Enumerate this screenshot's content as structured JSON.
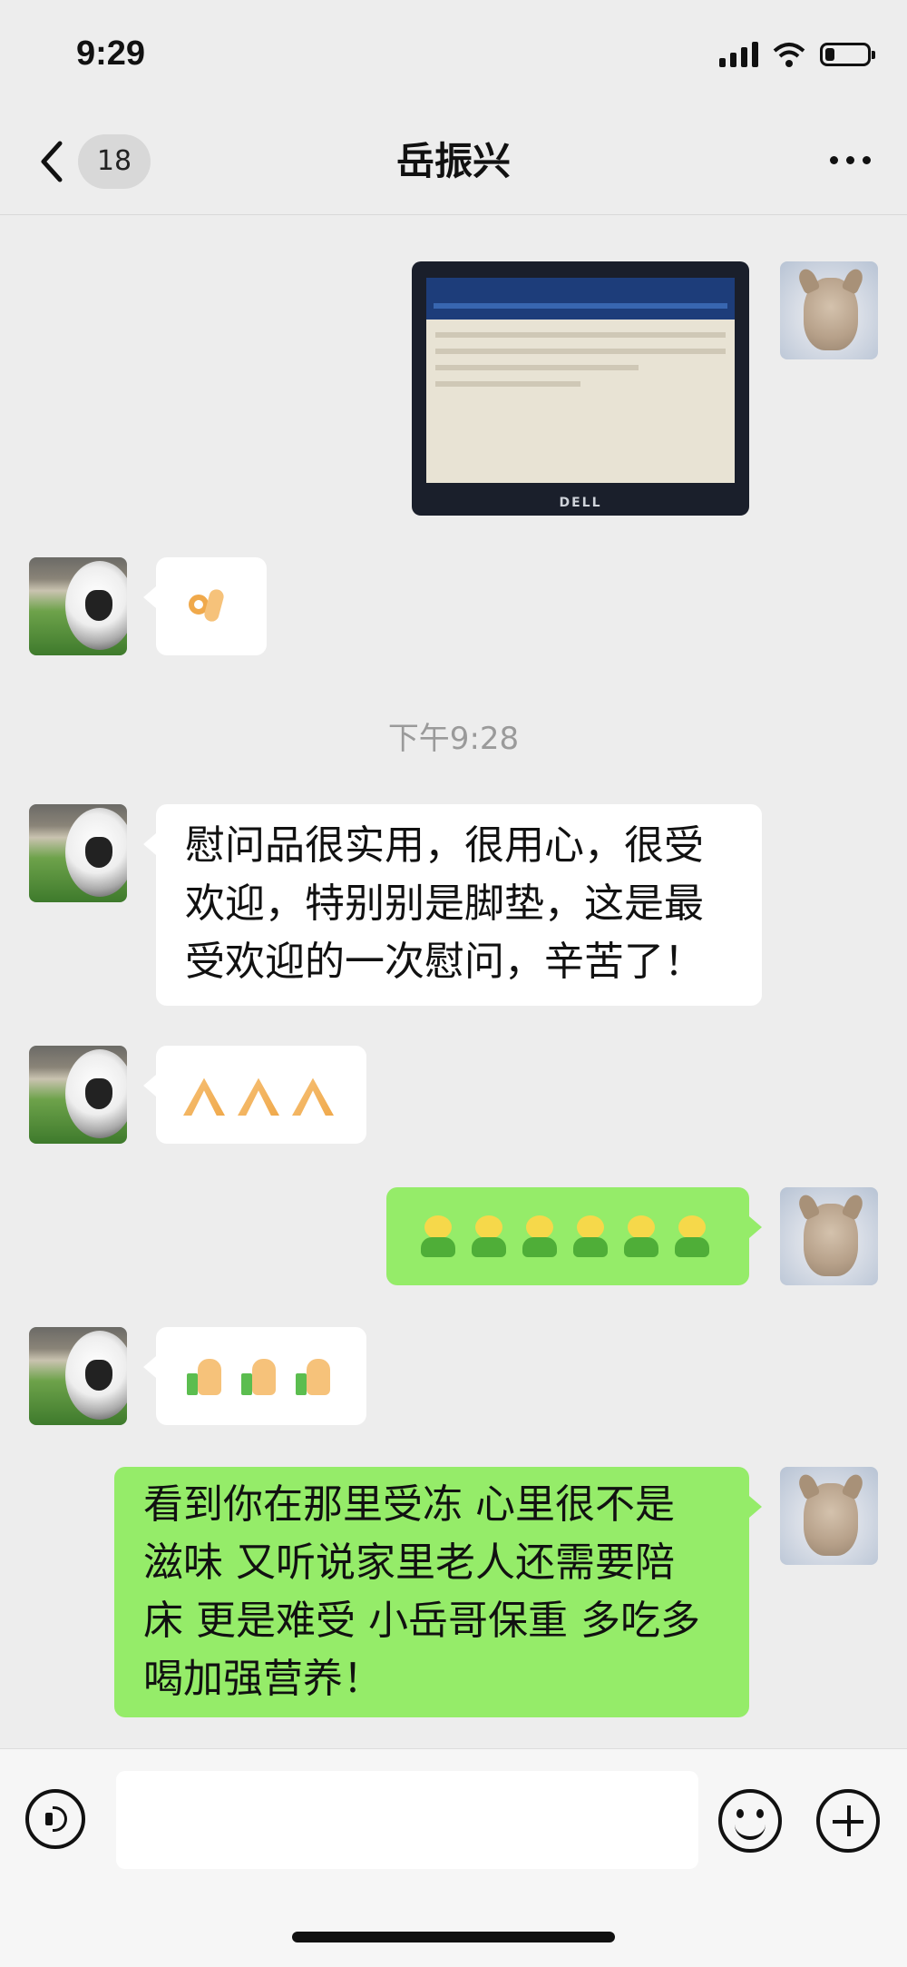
{
  "status_bar": {
    "time": "9:29"
  },
  "nav": {
    "badge": "18",
    "title": "岳振兴"
  },
  "timestamp": "下午9:28",
  "messages": {
    "m1_text": "慰问品很实用，很用心，很受欢迎，特别别是脚垫，这是最受欢迎的一次慰问，辛苦了！",
    "m1_line1": "慰问品很实用，很用心，很受",
    "m1_line2": "欢迎，特别别是脚垫，这是最",
    "m1_line3": "受欢迎的一次慰问，辛苦了！",
    "m2_line1": "看到你在那里受冻 心里很不是",
    "m2_line2": "滋味 又听说家里老人还需要陪",
    "m2_line3": "床 更是难受 小岳哥保重 多吃多",
    "m2_line4": "喝加强营养！"
  },
  "monitor": {
    "brand": "DELL"
  },
  "icons": {
    "back": "chevron-left-icon",
    "more": "more-dots-icon",
    "voice": "voice-icon",
    "emoji": "emoji-icon",
    "plus": "plus-icon"
  },
  "colors": {
    "outgoing_bubble": "#95ec69",
    "incoming_bubble": "#ffffff",
    "background": "#ededed"
  }
}
